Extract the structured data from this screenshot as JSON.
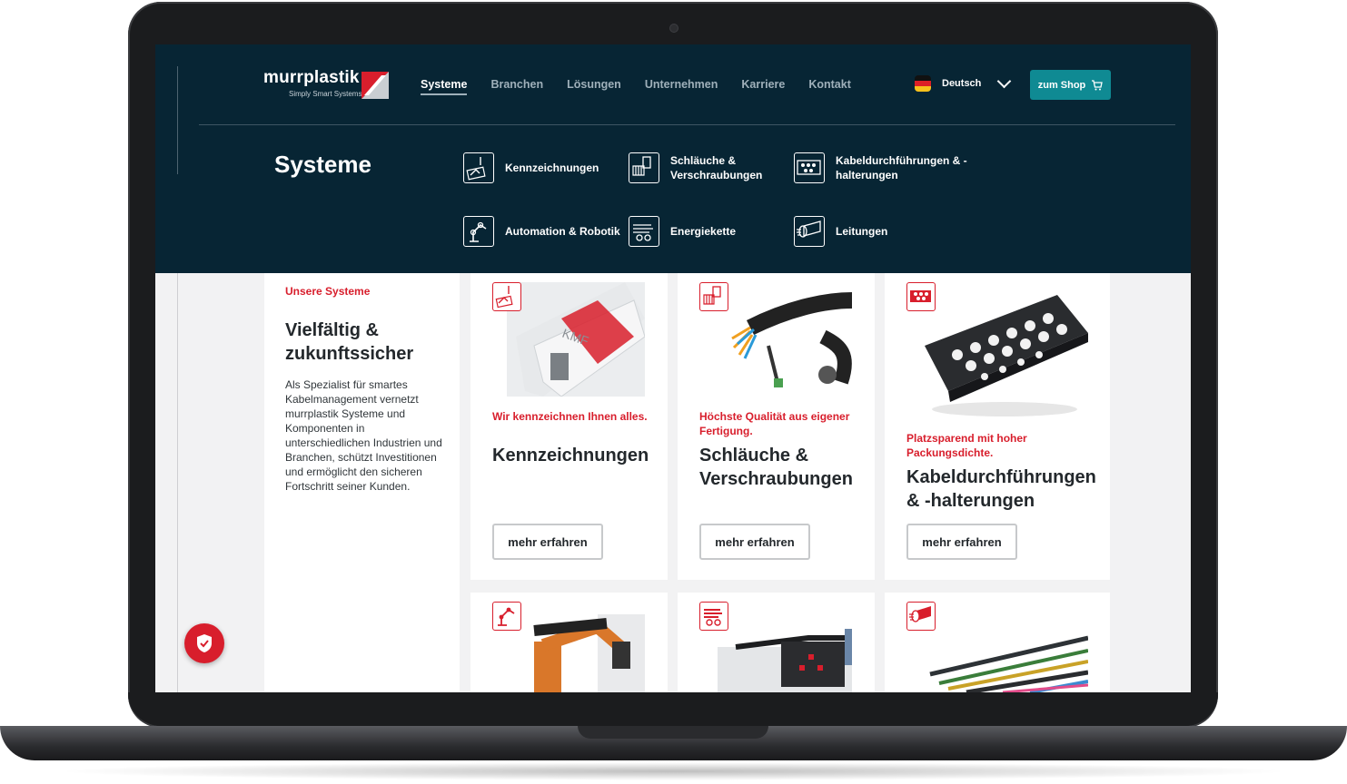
{
  "brand": {
    "name": "murrplastik",
    "tagline": "Simply Smart Systems",
    "accent": "#d81e2c",
    "navy": "#072534",
    "teal": "#0f8a93"
  },
  "nav": {
    "items": [
      "Systeme",
      "Branchen",
      "Lösungen",
      "Unternehmen",
      "Karriere",
      "Kontakt"
    ],
    "active": "Systeme"
  },
  "language": {
    "label": "Deutsch"
  },
  "shop": {
    "label": "zum Shop"
  },
  "mega": {
    "title": "Systeme",
    "items": [
      {
        "label": "Kennzeichnungen",
        "icon": "marking-icon"
      },
      {
        "label": "Schläuche & Verschraubungen",
        "icon": "hose-icon"
      },
      {
        "label": "Kabeldurchführungen & -halterungen",
        "icon": "cable-entry-icon"
      },
      {
        "label": "Automation & Robotik",
        "icon": "robot-arm-icon"
      },
      {
        "label": "Energiekette",
        "icon": "energy-chain-icon"
      },
      {
        "label": "Leitungen",
        "icon": "cable-icon"
      }
    ]
  },
  "intro": {
    "eyebrow": "Unsere Systeme",
    "title": "Vielfältig & zukunftssicher",
    "body": "Als Spezialist für smartes Kabelmanagement vernetzt murrplastik Systeme und Komponenten in unterschiedlichen Industrien und Branchen, schützt Investitionen und ermöglicht den sicheren Fortschritt seiner Kunden."
  },
  "cards": [
    {
      "tagline": "Wir kennzeichnen Ihnen alles.",
      "title": "Kennzeichnungen",
      "button": "mehr erfahren",
      "icon": "marking-icon"
    },
    {
      "tagline": "Höchste Qualität aus eigener Fertigung.",
      "title": "Schläuche & Verschraubungen",
      "button": "mehr erfahren",
      "icon": "hose-icon"
    },
    {
      "tagline": "Platzsparend mit hoher Packungsdichte.",
      "title": "Kabeldurchführungen & -halterungen",
      "button": "mehr erfahren",
      "icon": "cable-entry-icon"
    },
    {
      "icon": "robot-arm-icon"
    },
    {
      "icon": "energy-chain-icon"
    },
    {
      "icon": "cable-icon"
    }
  ]
}
